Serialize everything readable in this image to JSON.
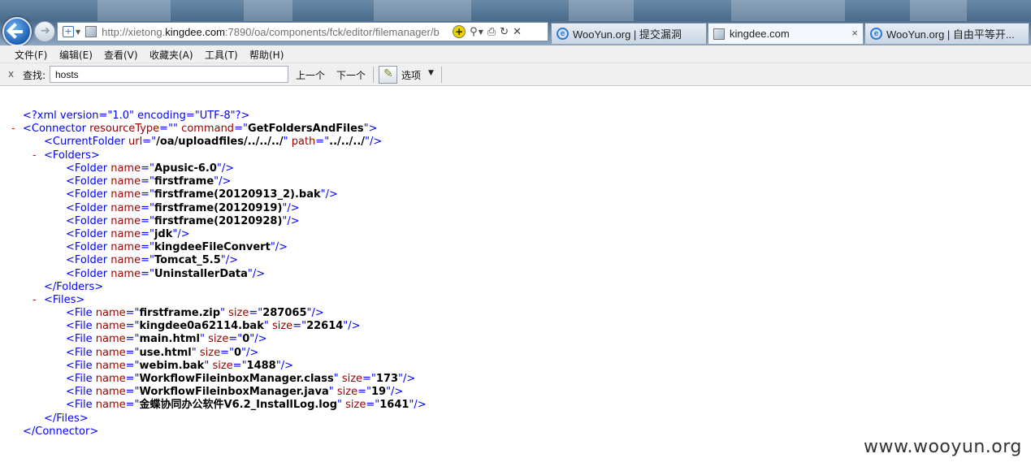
{
  "browser": {
    "url_prefix": "http://xietong.",
    "url_domain": "kingdee.com",
    "url_rest": ":7890/oa/components/fck/editor/filemanager/b",
    "tabs": [
      {
        "title": "WooYun.org | 提交漏洞",
        "icon": "ie-icon",
        "active": false
      },
      {
        "title": "kingdee.com",
        "icon": "page-icon",
        "active": true
      },
      {
        "title": "WooYun.org | 自由平等开...",
        "icon": "ie-icon",
        "active": false
      }
    ],
    "tab_close": "×"
  },
  "menu": {
    "items": [
      "文件(F)",
      "编辑(E)",
      "查看(V)",
      "收藏夹(A)",
      "工具(T)",
      "帮助(H)"
    ]
  },
  "findbar": {
    "close": "x",
    "label": "查找:",
    "query": "hosts",
    "prev": "上一个",
    "next": "下一个",
    "options": "选项"
  },
  "xml": {
    "declaration": "<?xml version=\"1.0\" encoding=\"UTF-8\"?>",
    "connector": {
      "resourceType": "",
      "command": "GetFoldersAndFiles"
    },
    "current_folder": {
      "url": "/oa/uploadfiles/../../../",
      "path": "../../../"
    },
    "folders": [
      "Apusic-6.0",
      "firstframe",
      "firstframe(20120913_2).bak",
      "firstframe(20120919)",
      "firstframe(20120928)",
      "jdk",
      "kingdeeFileConvert",
      "Tomcat_5.5",
      "UninstallerData"
    ],
    "files": [
      {
        "name": "firstframe.zip",
        "size": "287065"
      },
      {
        "name": "kingdee0a62114.bak",
        "size": "22614"
      },
      {
        "name": "main.html",
        "size": "0"
      },
      {
        "name": "use.html",
        "size": "0"
      },
      {
        "name": "webim.bak",
        "size": "1488"
      },
      {
        "name": "WorkflowFileinboxManager.class",
        "size": "173"
      },
      {
        "name": "WorkflowFileinboxManager.java",
        "size": "19"
      },
      {
        "name": "金蝶协同办公软件V6.2_InstallLog.log",
        "size": "1641"
      }
    ]
  },
  "watermark": "www.wooyun.org"
}
